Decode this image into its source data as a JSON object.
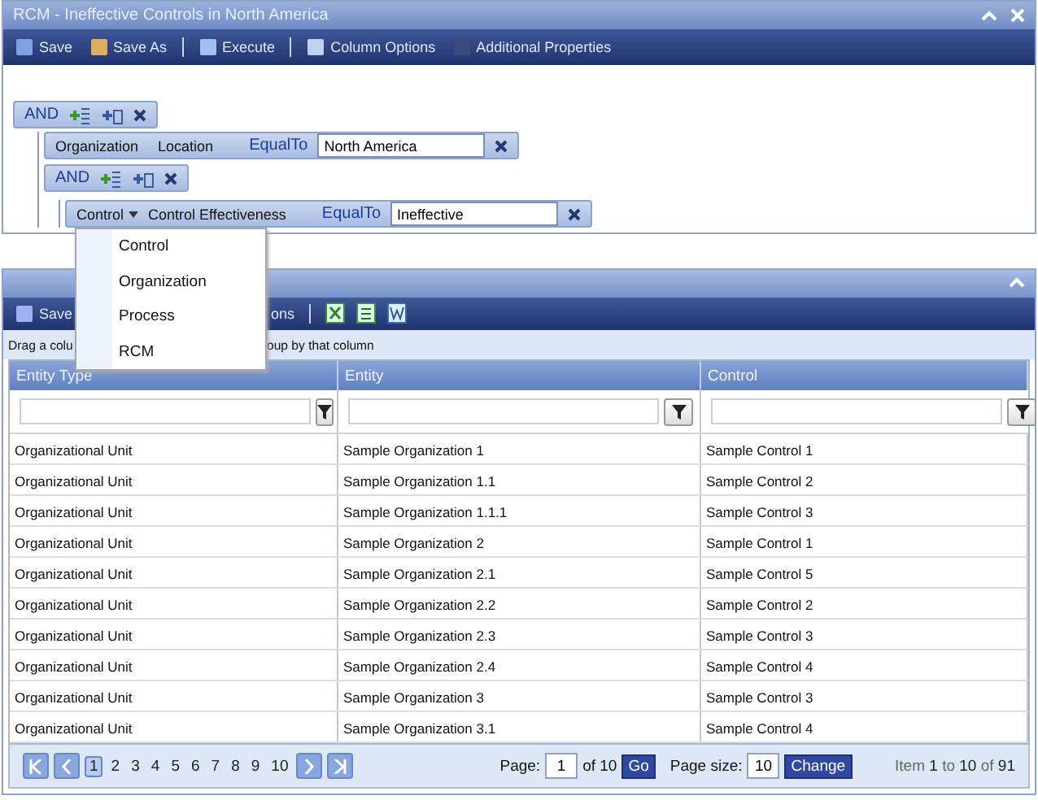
{
  "window": {
    "title": "RCM - Ineffective Controls in North America"
  },
  "toolbar": [
    {
      "label": "Save"
    },
    {
      "label": "Save As"
    },
    {
      "label": "Execute"
    },
    {
      "label": "Column Options"
    },
    {
      "label": "Additional Properties"
    }
  ],
  "filter": {
    "operator": "AND",
    "children": [
      {
        "kind": "condition",
        "entity": "Organization",
        "field": "Location",
        "op": "EqualTo",
        "value": "North America",
        "has_dropdown": false
      },
      {
        "kind": "group",
        "operator": "AND",
        "children": [
          {
            "kind": "condition",
            "entity": "Control",
            "field": "Control Effectiveness",
            "op": "EqualTo",
            "value": "Ineffective",
            "has_dropdown": true
          }
        ]
      }
    ]
  },
  "dropdown": {
    "items": [
      "Control",
      "Organization",
      "Process",
      "RCM"
    ]
  },
  "grid_toolbar": {
    "save": "Save",
    "partial": "ons"
  },
  "group_hint": {
    "left": "Drag a colu",
    "right": "oup by that column"
  },
  "table": {
    "columns": [
      "Entity Type",
      "Entity",
      "Control"
    ],
    "rows": [
      [
        "Organizational Unit",
        "Sample Organization 1",
        "Sample Control 1"
      ],
      [
        "Organizational Unit",
        "Sample Organization 1.1",
        "Sample Control 2"
      ],
      [
        "Organizational Unit",
        "Sample Organization 1.1.1",
        "Sample Control 3"
      ],
      [
        "Organizational Unit",
        "Sample Organization 2",
        "Sample Control 1"
      ],
      [
        "Organizational Unit",
        "Sample Organization 2.1",
        "Sample Control 5"
      ],
      [
        "Organizational Unit",
        "Sample Organization 2.2",
        "Sample Control 2"
      ],
      [
        "Organizational Unit",
        "Sample Organization 2.3",
        "Sample Control 3"
      ],
      [
        "Organizational Unit",
        "Sample Organization 2.4",
        "Sample Control 4"
      ],
      [
        "Organizational Unit",
        "Sample Organization 3",
        "Sample Control 3"
      ],
      [
        "Organizational Unit",
        "Sample Organization 3.1",
        "Sample Control 4"
      ]
    ]
  },
  "pager": {
    "pages": [
      {
        "label": "1",
        "selected": true
      },
      {
        "label": "2",
        "selected": false
      },
      {
        "label": "3",
        "selected": false
      },
      {
        "label": "4",
        "selected": false
      },
      {
        "label": "5",
        "selected": false
      },
      {
        "label": "6",
        "selected": false
      },
      {
        "label": "7",
        "selected": false
      },
      {
        "label": "8",
        "selected": false
      },
      {
        "label": "9",
        "selected": false
      },
      {
        "label": "10",
        "selected": false
      }
    ],
    "page_label": "Page:",
    "page_value": "1",
    "of": "of 10",
    "go": "Go",
    "size_label": "Page size:",
    "size_value": "10",
    "change": "Change",
    "info": "Item **1** to **10** of **91**"
  }
}
